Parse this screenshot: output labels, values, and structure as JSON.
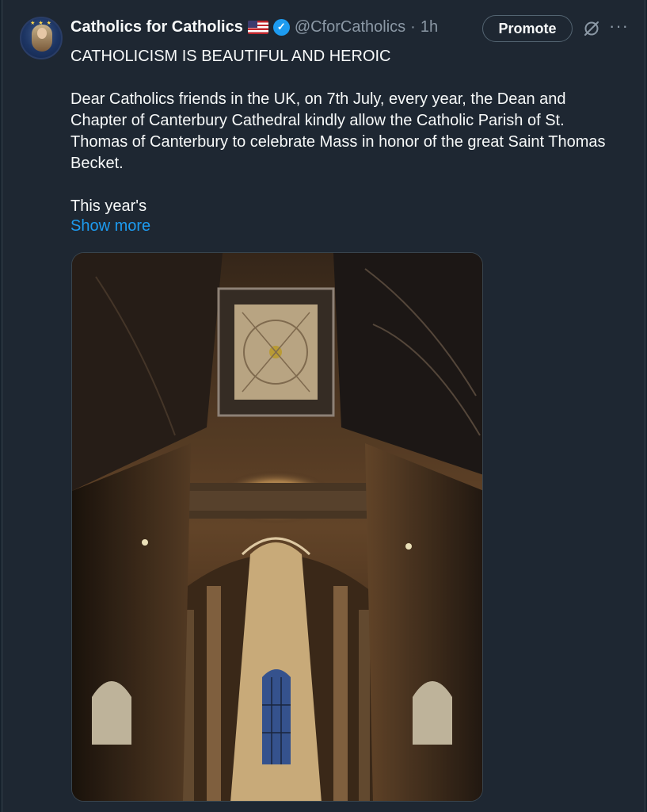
{
  "author": {
    "name": "Catholics for Catholics",
    "handle": "@CforCatholics",
    "separator": "·",
    "time": "1h",
    "flag_icon": "us-flag-icon",
    "verified_icon": "verified-badge-icon"
  },
  "actions": {
    "promote_label": "Promote",
    "grok_icon": "grok-icon",
    "more_label": "···"
  },
  "post": {
    "headline": "CATHOLICISM IS BEAUTIFUL AND HEROIC",
    "paragraph": "Dear Catholics friends in the UK, on 7th July, every year, the Dean and Chapter of Canterbury Cathedral kindly allow the Catholic Parish of St. Thomas of Canterbury to celebrate Mass in honor of the great Saint Thomas Becket.",
    "truncated": "This year's",
    "show_more": "Show more"
  },
  "media": {
    "alt": "Canterbury Cathedral vaulted ceiling"
  },
  "colors": {
    "background": "#15202b",
    "accent": "#1d9bf0",
    "secondary_text": "#8b98a5"
  }
}
